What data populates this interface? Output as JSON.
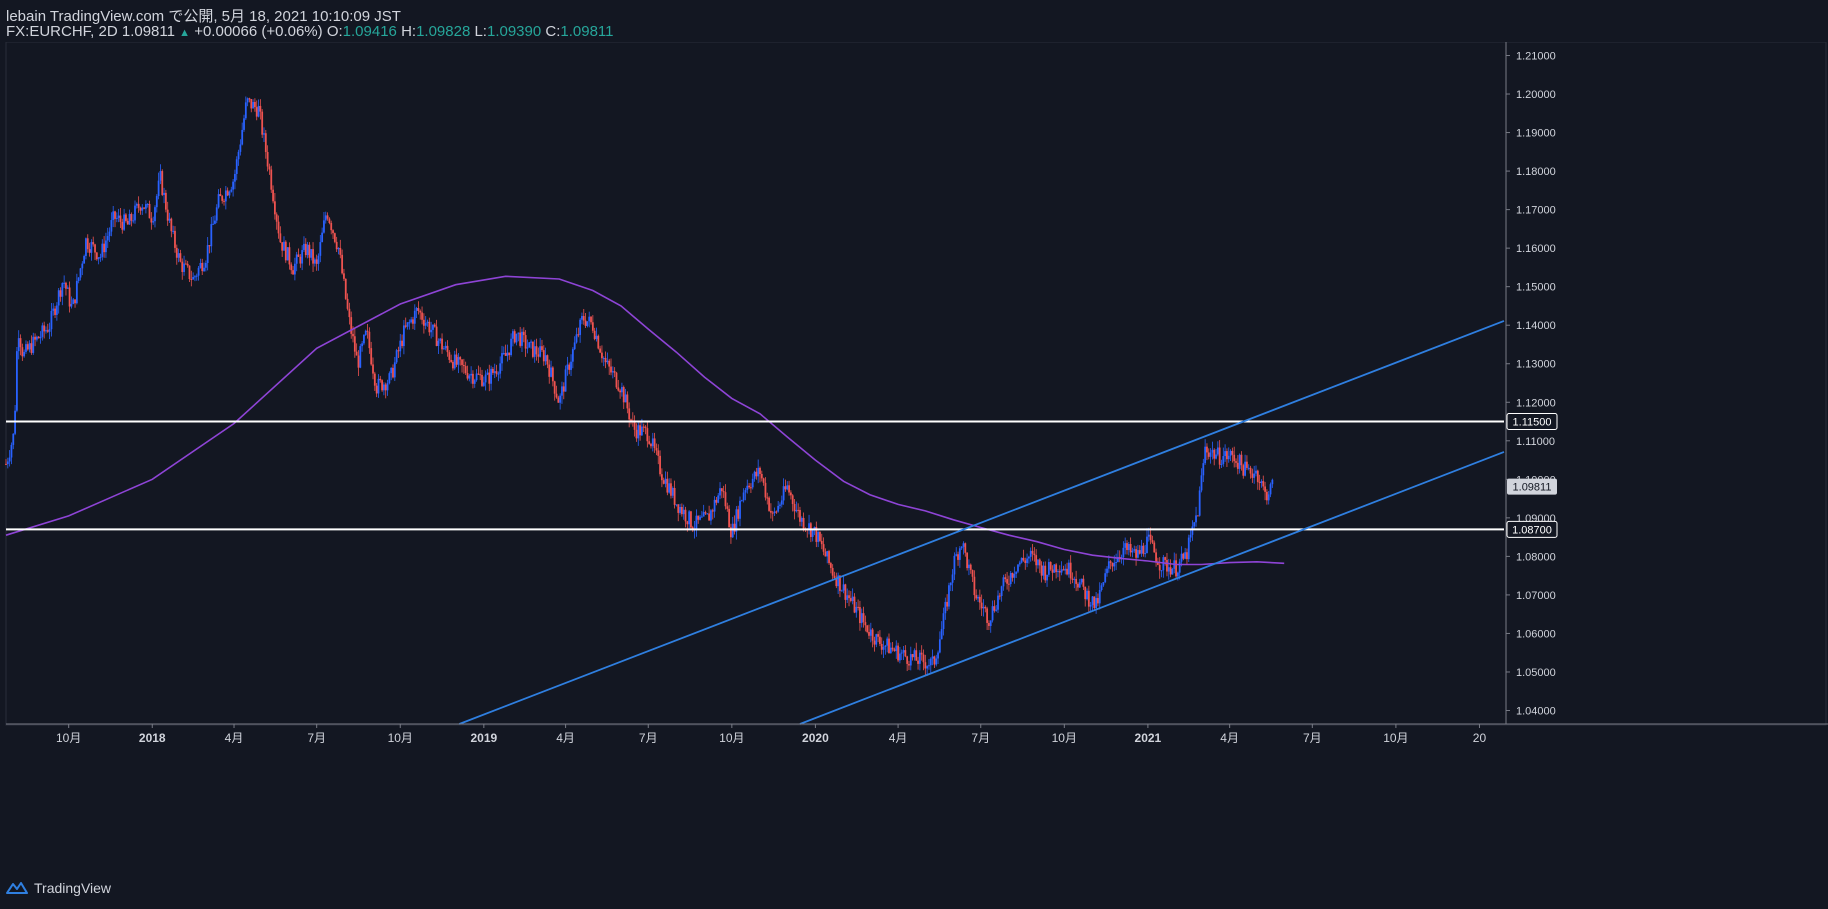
{
  "header": {
    "publish_line": "lebain TradingView.com で公開, 5月 18, 2021 10:10:09 JST",
    "symbol": "FX:EURCHF, 2D",
    "last": "1.09811",
    "change_arrow": "▲",
    "change": "+0.00066 (+0.06%)",
    "o_label": "O:",
    "o_value": "1.09416",
    "h_label": "H:",
    "h_value": "1.09828",
    "l_label": "L:",
    "l_value": "1.09390",
    "c_label": "C:",
    "c_value": "1.09811"
  },
  "footer": {
    "brand": "TradingView",
    "logo_icon": "tradingview-logo-icon"
  },
  "colors": {
    "background": "#131722",
    "up_candle": "#2962ff",
    "down_candle": "#ef5350",
    "moving_average": "#8e44d6",
    "trendline": "#2f7fe0",
    "horizontal_line": "#ffffff",
    "axis_text": "#d1d4dc",
    "price_label_bg": "#d1d4dc"
  },
  "chart_data": {
    "type": "candlestick",
    "symbol": "FX:EURCHF",
    "interval": "2D",
    "ylim": [
      1.0365,
      1.2135
    ],
    "y_ticks": [
      "1.21000",
      "1.20000",
      "1.19000",
      "1.18000",
      "1.17000",
      "1.16000",
      "1.15000",
      "1.14000",
      "1.13000",
      "1.12000",
      "1.11000",
      "1.10000",
      "1.09000",
      "1.08000",
      "1.07000",
      "1.06000",
      "1.05000",
      "1.04000"
    ],
    "x_ticks": [
      "10月",
      "2018",
      "4月",
      "7月",
      "10月",
      "2019",
      "4月",
      "7月",
      "10月",
      "2020",
      "4月",
      "7月",
      "10月",
      "2021",
      "4月",
      "7月",
      "10月",
      "20"
    ],
    "x_tick_dates": [
      "2017-10-01",
      "2018-01-01",
      "2018-04-01",
      "2018-07-01",
      "2018-10-01",
      "2019-01-01",
      "2019-04-01",
      "2019-07-01",
      "2019-10-01",
      "2020-01-01",
      "2020-04-01",
      "2020-07-01",
      "2020-10-01",
      "2021-01-01",
      "2021-04-01",
      "2021-07-01",
      "2021-10-01",
      "2022-01-01"
    ],
    "xlim": [
      "2017-07-24",
      "2022-01-28"
    ],
    "price_path": [
      [
        "2017-07-24",
        1.104
      ],
      [
        "2017-08-02",
        1.112
      ],
      [
        "2017-08-06",
        1.14
      ],
      [
        "2017-08-12",
        1.132
      ],
      [
        "2017-08-22",
        1.135
      ],
      [
        "2017-09-10",
        1.14
      ],
      [
        "2017-09-25",
        1.152
      ],
      [
        "2017-10-05",
        1.144
      ],
      [
        "2017-10-20",
        1.162
      ],
      [
        "2017-11-05",
        1.158
      ],
      [
        "2017-11-20",
        1.168
      ],
      [
        "2017-12-05",
        1.166
      ],
      [
        "2017-12-20",
        1.172
      ],
      [
        "2018-01-01",
        1.168
      ],
      [
        "2018-01-10",
        1.178
      ],
      [
        "2018-01-22",
        1.164
      ],
      [
        "2018-02-01",
        1.156
      ],
      [
        "2018-02-15",
        1.152
      ],
      [
        "2018-03-01",
        1.158
      ],
      [
        "2018-03-15",
        1.172
      ],
      [
        "2018-04-01",
        1.178
      ],
      [
        "2018-04-15",
        1.198
      ],
      [
        "2018-04-28",
        1.196
      ],
      [
        "2018-05-10",
        1.18
      ],
      [
        "2018-05-22",
        1.162
      ],
      [
        "2018-06-05",
        1.155
      ],
      [
        "2018-06-20",
        1.16
      ],
      [
        "2018-07-01",
        1.155
      ],
      [
        "2018-07-12",
        1.17
      ],
      [
        "2018-07-25",
        1.16
      ],
      [
        "2018-08-05",
        1.142
      ],
      [
        "2018-08-15",
        1.13
      ],
      [
        "2018-08-25",
        1.138
      ],
      [
        "2018-09-05",
        1.124
      ],
      [
        "2018-09-20",
        1.126
      ],
      [
        "2018-10-05",
        1.138
      ],
      [
        "2018-10-20",
        1.144
      ],
      [
        "2018-11-01",
        1.14
      ],
      [
        "2018-11-15",
        1.135
      ],
      [
        "2018-12-01",
        1.13
      ],
      [
        "2018-12-20",
        1.127
      ],
      [
        "2019-01-05",
        1.126
      ],
      [
        "2019-01-25",
        1.132
      ],
      [
        "2019-02-05",
        1.138
      ],
      [
        "2019-02-20",
        1.134
      ],
      [
        "2019-03-10",
        1.132
      ],
      [
        "2019-03-25",
        1.12
      ],
      [
        "2019-04-05",
        1.13
      ],
      [
        "2019-04-20",
        1.142
      ],
      [
        "2019-05-01",
        1.14
      ],
      [
        "2019-05-15",
        1.13
      ],
      [
        "2019-06-01",
        1.124
      ],
      [
        "2019-06-15",
        1.113
      ],
      [
        "2019-07-01",
        1.112
      ],
      [
        "2019-07-15",
        1.102
      ],
      [
        "2019-08-01",
        1.094
      ],
      [
        "2019-08-20",
        1.088
      ],
      [
        "2019-09-05",
        1.09
      ],
      [
        "2019-09-20",
        1.098
      ],
      [
        "2019-10-01",
        1.086
      ],
      [
        "2019-10-15",
        1.098
      ],
      [
        "2019-11-01",
        1.102
      ],
      [
        "2019-11-15",
        1.09
      ],
      [
        "2019-12-01",
        1.098
      ],
      [
        "2019-12-15",
        1.09
      ],
      [
        "2020-01-01",
        1.086
      ],
      [
        "2020-01-20",
        1.076
      ],
      [
        "2020-02-05",
        1.07
      ],
      [
        "2020-02-25",
        1.062
      ],
      [
        "2020-03-10",
        1.058
      ],
      [
        "2020-03-25",
        1.056
      ],
      [
        "2020-04-10",
        1.054
      ],
      [
        "2020-04-25",
        1.053
      ],
      [
        "2020-05-10",
        1.052
      ],
      [
        "2020-05-20",
        1.062
      ],
      [
        "2020-06-01",
        1.078
      ],
      [
        "2020-06-10",
        1.084
      ],
      [
        "2020-06-25",
        1.07
      ],
      [
        "2020-07-10",
        1.064
      ],
      [
        "2020-07-25",
        1.072
      ],
      [
        "2020-08-10",
        1.078
      ],
      [
        "2020-08-25",
        1.08
      ],
      [
        "2020-09-10",
        1.076
      ],
      [
        "2020-09-25",
        1.078
      ],
      [
        "2020-10-10",
        1.076
      ],
      [
        "2020-10-25",
        1.07
      ],
      [
        "2020-11-05",
        1.067
      ],
      [
        "2020-11-20",
        1.078
      ],
      [
        "2020-12-05",
        1.082
      ],
      [
        "2020-12-20",
        1.08
      ],
      [
        "2021-01-01",
        1.084
      ],
      [
        "2021-01-15",
        1.078
      ],
      [
        "2021-02-01",
        1.077
      ],
      [
        "2021-02-12",
        1.08
      ],
      [
        "2021-02-25",
        1.092
      ],
      [
        "2021-03-05",
        1.108
      ],
      [
        "2021-03-20",
        1.106
      ],
      [
        "2021-04-05",
        1.106
      ],
      [
        "2021-04-20",
        1.102
      ],
      [
        "2021-05-01",
        1.102
      ],
      [
        "2021-05-10",
        1.096
      ],
      [
        "2021-05-18",
        1.098
      ]
    ],
    "moving_average": [
      [
        "2017-07-24",
        1.0855
      ],
      [
        "2017-10-01",
        1.0905
      ],
      [
        "2018-01-01",
        1.1
      ],
      [
        "2018-04-01",
        1.1145
      ],
      [
        "2018-07-01",
        1.134
      ],
      [
        "2018-10-01",
        1.1455
      ],
      [
        "2018-12-01",
        1.1505
      ],
      [
        "2019-01-25",
        1.1527
      ],
      [
        "2019-03-25",
        1.152
      ],
      [
        "2019-05-01",
        1.149
      ],
      [
        "2019-06-01",
        1.145
      ],
      [
        "2019-07-01",
        1.139
      ],
      [
        "2019-08-01",
        1.133
      ],
      [
        "2019-09-01",
        1.1265
      ],
      [
        "2019-10-01",
        1.121
      ],
      [
        "2019-11-01",
        1.117
      ],
      [
        "2019-12-01",
        1.111
      ],
      [
        "2020-01-01",
        1.105
      ],
      [
        "2020-02-01",
        1.0995
      ],
      [
        "2020-03-01",
        1.096
      ],
      [
        "2020-04-01",
        1.0935
      ],
      [
        "2020-05-01",
        1.0918
      ],
      [
        "2020-06-01",
        1.0895
      ],
      [
        "2020-07-01",
        1.0875
      ],
      [
        "2020-08-01",
        1.0855
      ],
      [
        "2020-09-01",
        1.0838
      ],
      [
        "2020-10-01",
        1.0818
      ],
      [
        "2020-11-01",
        1.0803
      ],
      [
        "2020-12-01",
        1.0795
      ],
      [
        "2021-01-01",
        1.0788
      ],
      [
        "2021-02-01",
        1.0779
      ],
      [
        "2021-03-01",
        1.0779
      ],
      [
        "2021-04-01",
        1.0784
      ],
      [
        "2021-05-01",
        1.0786
      ],
      [
        "2021-05-31",
        1.0782
      ]
    ],
    "horizontal_lines": [
      1.115,
      1.087
    ],
    "trendlines": [
      {
        "from": [
          "2018-12-05",
          1.0365
        ],
        "to": [
          "2022-01-28",
          1.1411
        ]
      },
      {
        "from": [
          "2019-12-15",
          1.0365
        ],
        "to": [
          "2022-01-28",
          1.1071
        ]
      }
    ],
    "price_labels": [
      {
        "value": "1.11500",
        "price": 1.115,
        "style": "outlined"
      },
      {
        "value": "1.09811",
        "price": 1.09811,
        "style": "filled"
      },
      {
        "value": "1.08700",
        "price": 1.087,
        "style": "outlined"
      }
    ]
  }
}
